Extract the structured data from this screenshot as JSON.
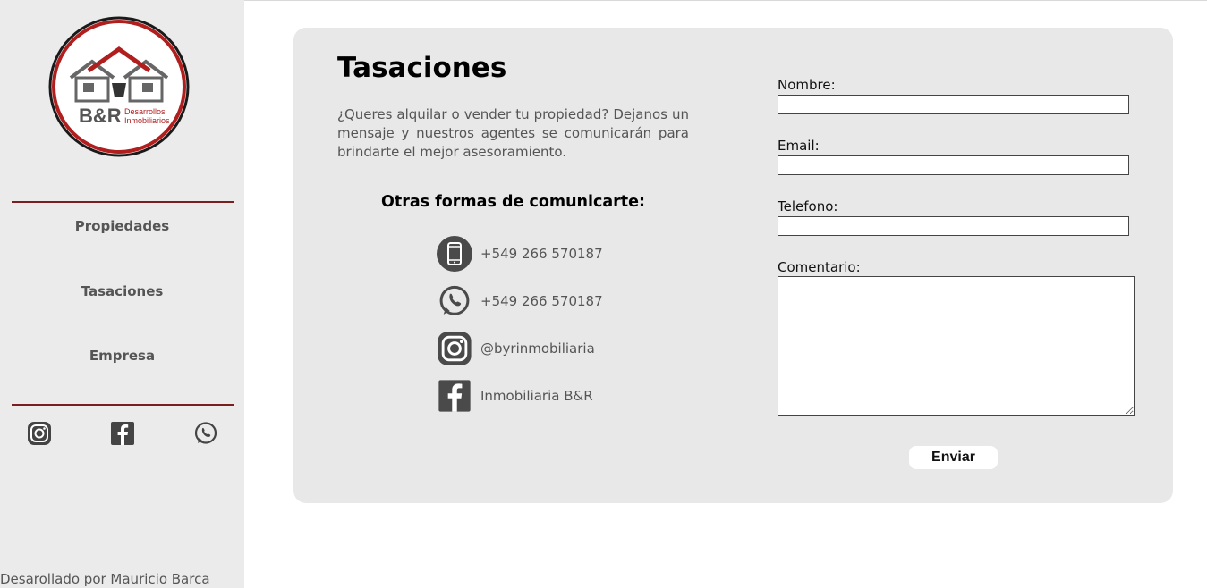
{
  "brand": {
    "logo_main": "B&R",
    "logo_line1": "Desarrollos",
    "logo_line2": "Inmobiliarios",
    "accent_color": "#7a1f1f",
    "logo_red": "#b01e1e"
  },
  "sidebar": {
    "nav": [
      {
        "label": "Propiedades"
      },
      {
        "label": "Tasaciones"
      },
      {
        "label": "Empresa"
      }
    ],
    "social_icons": [
      "instagram-icon",
      "facebook-icon",
      "whatsapp-icon"
    ],
    "credit": "Desarollado por Mauricio Barca"
  },
  "main": {
    "title": "Tasaciones",
    "intro": "¿Queres alquilar o vender tu propiedad? Dejanos un mensaje y nuestros agentes se comunicarán para brindarte el mejor asesoramiento.",
    "other_title": "Otras formas de comunicarte:",
    "contacts": [
      {
        "icon": "phone-icon",
        "text": "+549 266 570187"
      },
      {
        "icon": "whatsapp-icon",
        "text": "+549 266 570187"
      },
      {
        "icon": "instagram-icon",
        "text": "@byrinmobiliaria"
      },
      {
        "icon": "facebook-icon",
        "text": "Inmobiliaria B&R"
      }
    ]
  },
  "form": {
    "nombre_label": "Nombre:",
    "nombre_value": "",
    "email_label": "Email:",
    "email_value": "",
    "telefono_label": "Telefono:",
    "telefono_value": "",
    "comentario_label": "Comentario:",
    "comentario_value": "",
    "submit_label": "Enviar"
  }
}
